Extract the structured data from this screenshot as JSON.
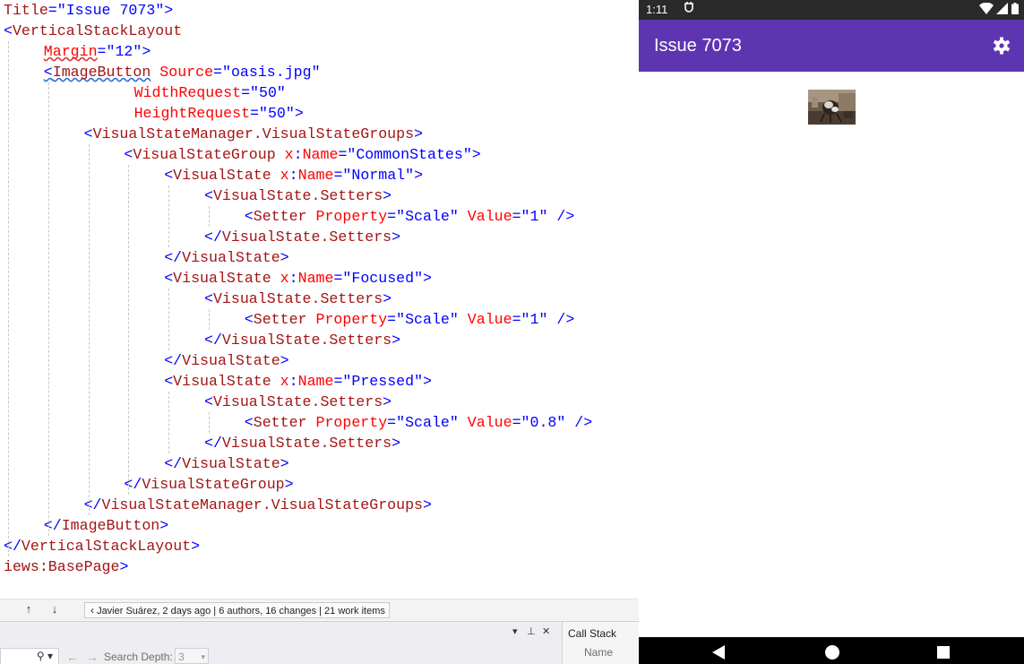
{
  "editor": {
    "lines": [
      {
        "indent": 0,
        "tokens": [
          {
            "c": "m",
            "t": "Title"
          },
          {
            "c": "b",
            "t": "=\""
          },
          {
            "c": "b",
            "t": "Issue 7073"
          },
          {
            "c": "b",
            "t": "\">"
          }
        ]
      },
      {
        "indent": 0,
        "tokens": [
          {
            "c": "b",
            "t": "<"
          },
          {
            "c": "m",
            "t": "VerticalStackLayout"
          }
        ]
      },
      {
        "indent": 4,
        "tokens": [
          {
            "c": "r",
            "t": "Margin",
            "sq": "r"
          },
          {
            "c": "b",
            "t": "=\"12\">"
          }
        ]
      },
      {
        "indent": 4,
        "tokens": [
          {
            "c": "b",
            "t": "<",
            "sq": "b"
          },
          {
            "c": "m",
            "t": "ImageButton",
            "sq": "b"
          },
          {
            "c": "k",
            "t": " "
          },
          {
            "c": "r",
            "t": "Source"
          },
          {
            "c": "b",
            "t": "=\"oasis.jpg\""
          }
        ]
      },
      {
        "indent": 13,
        "tokens": [
          {
            "c": "r",
            "t": "WidthRequest"
          },
          {
            "c": "b",
            "t": "=\"50\""
          }
        ]
      },
      {
        "indent": 13,
        "tokens": [
          {
            "c": "r",
            "t": "HeightRequest"
          },
          {
            "c": "b",
            "t": "=\"50\">"
          }
        ]
      },
      {
        "indent": 8,
        "tokens": [
          {
            "c": "b",
            "t": "<"
          },
          {
            "c": "m",
            "t": "VisualStateManager.VisualStateGroups"
          },
          {
            "c": "b",
            "t": ">"
          }
        ]
      },
      {
        "indent": 12,
        "tokens": [
          {
            "c": "b",
            "t": "<"
          },
          {
            "c": "m",
            "t": "VisualStateGroup"
          },
          {
            "c": "k",
            "t": " "
          },
          {
            "c": "r",
            "t": "x"
          },
          {
            "c": "b",
            "t": ":"
          },
          {
            "c": "r",
            "t": "Name"
          },
          {
            "c": "b",
            "t": "=\"CommonStates\">"
          }
        ]
      },
      {
        "indent": 16,
        "tokens": [
          {
            "c": "b",
            "t": "<"
          },
          {
            "c": "m",
            "t": "VisualState"
          },
          {
            "c": "k",
            "t": " "
          },
          {
            "c": "r",
            "t": "x"
          },
          {
            "c": "b",
            "t": ":"
          },
          {
            "c": "r",
            "t": "Name"
          },
          {
            "c": "b",
            "t": "=\"Normal\">"
          }
        ]
      },
      {
        "indent": 20,
        "tokens": [
          {
            "c": "b",
            "t": "<"
          },
          {
            "c": "m",
            "t": "VisualState.Setters"
          },
          {
            "c": "b",
            "t": ">"
          }
        ]
      },
      {
        "indent": 24,
        "tokens": [
          {
            "c": "b",
            "t": "<"
          },
          {
            "c": "m",
            "t": "Setter"
          },
          {
            "c": "k",
            "t": " "
          },
          {
            "c": "r",
            "t": "Property"
          },
          {
            "c": "b",
            "t": "=\"Scale\""
          },
          {
            "c": "k",
            "t": " "
          },
          {
            "c": "r",
            "t": "Value"
          },
          {
            "c": "b",
            "t": "=\"1\" />"
          }
        ]
      },
      {
        "indent": 20,
        "tokens": [
          {
            "c": "b",
            "t": "</"
          },
          {
            "c": "m",
            "t": "VisualState.Setters"
          },
          {
            "c": "b",
            "t": ">"
          }
        ]
      },
      {
        "indent": 16,
        "tokens": [
          {
            "c": "b",
            "t": "</"
          },
          {
            "c": "m",
            "t": "VisualState"
          },
          {
            "c": "b",
            "t": ">"
          }
        ]
      },
      {
        "indent": 16,
        "tokens": [
          {
            "c": "b",
            "t": "<"
          },
          {
            "c": "m",
            "t": "VisualState"
          },
          {
            "c": "k",
            "t": " "
          },
          {
            "c": "r",
            "t": "x"
          },
          {
            "c": "b",
            "t": ":"
          },
          {
            "c": "r",
            "t": "Name"
          },
          {
            "c": "b",
            "t": "=\"Focused\">"
          }
        ]
      },
      {
        "indent": 20,
        "tokens": [
          {
            "c": "b",
            "t": "<"
          },
          {
            "c": "m",
            "t": "VisualState.Setters"
          },
          {
            "c": "b",
            "t": ">"
          }
        ]
      },
      {
        "indent": 24,
        "tokens": [
          {
            "c": "b",
            "t": "<"
          },
          {
            "c": "m",
            "t": "Setter"
          },
          {
            "c": "k",
            "t": " "
          },
          {
            "c": "r",
            "t": "Property"
          },
          {
            "c": "b",
            "t": "=\"Scale\""
          },
          {
            "c": "k",
            "t": " "
          },
          {
            "c": "r",
            "t": "Value"
          },
          {
            "c": "b",
            "t": "=\"1\" />"
          }
        ]
      },
      {
        "indent": 20,
        "tokens": [
          {
            "c": "b",
            "t": "</"
          },
          {
            "c": "m",
            "t": "VisualState.Setters"
          },
          {
            "c": "b",
            "t": ">"
          }
        ]
      },
      {
        "indent": 16,
        "tokens": [
          {
            "c": "b",
            "t": "</"
          },
          {
            "c": "m",
            "t": "VisualState"
          },
          {
            "c": "b",
            "t": ">"
          }
        ]
      },
      {
        "indent": 16,
        "tokens": [
          {
            "c": "b",
            "t": "<"
          },
          {
            "c": "m",
            "t": "VisualState"
          },
          {
            "c": "k",
            "t": " "
          },
          {
            "c": "r",
            "t": "x"
          },
          {
            "c": "b",
            "t": ":"
          },
          {
            "c": "r",
            "t": "Name"
          },
          {
            "c": "b",
            "t": "=\"Pressed\">"
          }
        ]
      },
      {
        "indent": 20,
        "tokens": [
          {
            "c": "b",
            "t": "<"
          },
          {
            "c": "m",
            "t": "VisualState.Setters"
          },
          {
            "c": "b",
            "t": ">"
          }
        ]
      },
      {
        "indent": 24,
        "tokens": [
          {
            "c": "b",
            "t": "<"
          },
          {
            "c": "m",
            "t": "Setter"
          },
          {
            "c": "k",
            "t": " "
          },
          {
            "c": "r",
            "t": "Property"
          },
          {
            "c": "b",
            "t": "=\"Scale\""
          },
          {
            "c": "k",
            "t": " "
          },
          {
            "c": "r",
            "t": "Value"
          },
          {
            "c": "b",
            "t": "=\"0.8\" />"
          }
        ]
      },
      {
        "indent": 20,
        "tokens": [
          {
            "c": "b",
            "t": "</"
          },
          {
            "c": "m",
            "t": "VisualState.Setters"
          },
          {
            "c": "b",
            "t": ">"
          }
        ]
      },
      {
        "indent": 16,
        "tokens": [
          {
            "c": "b",
            "t": "</"
          },
          {
            "c": "m",
            "t": "VisualState"
          },
          {
            "c": "b",
            "t": ">"
          }
        ]
      },
      {
        "indent": 12,
        "tokens": [
          {
            "c": "b",
            "t": "</"
          },
          {
            "c": "m",
            "t": "VisualStateGroup"
          },
          {
            "c": "b",
            "t": ">"
          }
        ]
      },
      {
        "indent": 8,
        "tokens": [
          {
            "c": "b",
            "t": "</"
          },
          {
            "c": "m",
            "t": "VisualStateManager.VisualStateGroups"
          },
          {
            "c": "b",
            "t": ">"
          }
        ]
      },
      {
        "indent": 4,
        "tokens": [
          {
            "c": "b",
            "t": "</"
          },
          {
            "c": "m",
            "t": "ImageButton"
          },
          {
            "c": "b",
            "t": ">"
          }
        ]
      },
      {
        "indent": 0,
        "tokens": [
          {
            "c": "b",
            "t": "</"
          },
          {
            "c": "m",
            "t": "VerticalStackLayout"
          },
          {
            "c": "b",
            "t": ">"
          }
        ]
      },
      {
        "indent": 0,
        "tokens": [
          {
            "c": "m",
            "t": "iews:BasePage"
          },
          {
            "c": "b",
            "t": ">"
          }
        ]
      }
    ],
    "codelens": "Javier Suárez, 2 days ago | 6 authors, 16 changes | 21 work items"
  },
  "bottom_panel": {
    "search_depth_label": "Search Depth:",
    "search_depth_value": "3",
    "callstack_title": "Call Stack",
    "callstack_column": "Name"
  },
  "emulator": {
    "time": "1:11",
    "app_title": "Issue 7073",
    "icons": [
      "notification-icon",
      "wifi-icon",
      "signal-icon",
      "battery-icon",
      "gear-icon",
      "back-icon",
      "home-icon",
      "recents-icon"
    ]
  },
  "colors": {
    "app_bar": "#5e35b1",
    "xaml_bracket": "#0000ff",
    "xaml_element": "#a31515",
    "xaml_attribute": "#ff0000"
  }
}
